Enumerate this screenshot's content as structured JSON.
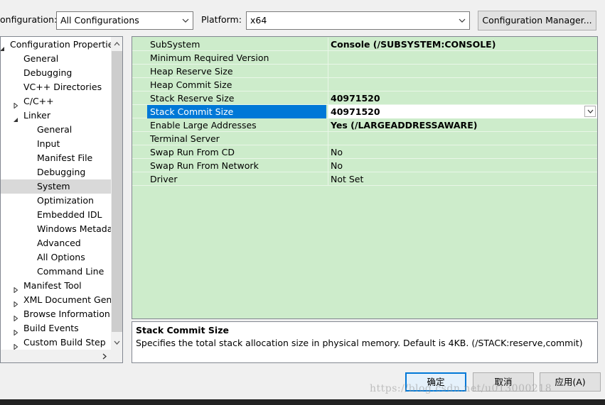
{
  "toolbar": {
    "configuration_label": "onfiguration:",
    "configuration_value": "All Configurations",
    "platform_label": "Platform:",
    "platform_value": "x64",
    "config_manager_label": "Configuration Manager..."
  },
  "tree": {
    "items": [
      {
        "label": "Configuration Properties",
        "level": 0,
        "expander": "expanded"
      },
      {
        "label": "General",
        "level": 1
      },
      {
        "label": "Debugging",
        "level": 1
      },
      {
        "label": "VC++ Directories",
        "level": 1
      },
      {
        "label": "C/C++",
        "level": 1,
        "expander": "collapsed"
      },
      {
        "label": "Linker",
        "level": 1,
        "expander": "expanded"
      },
      {
        "label": "General",
        "level": 2
      },
      {
        "label": "Input",
        "level": 2
      },
      {
        "label": "Manifest File",
        "level": 2
      },
      {
        "label": "Debugging",
        "level": 2
      },
      {
        "label": "System",
        "level": 2,
        "selected": true
      },
      {
        "label": "Optimization",
        "level": 2
      },
      {
        "label": "Embedded IDL",
        "level": 2
      },
      {
        "label": "Windows Metada",
        "level": 2
      },
      {
        "label": "Advanced",
        "level": 2
      },
      {
        "label": "All Options",
        "level": 2
      },
      {
        "label": "Command Line",
        "level": 2
      },
      {
        "label": "Manifest Tool",
        "level": 1,
        "expander": "collapsed"
      },
      {
        "label": "XML Document Gene",
        "level": 1,
        "expander": "collapsed"
      },
      {
        "label": "Browse Information",
        "level": 1,
        "expander": "collapsed"
      },
      {
        "label": "Build Events",
        "level": 1,
        "expander": "collapsed"
      },
      {
        "label": "Custom Build Step",
        "level": 1,
        "expander": "collapsed"
      }
    ]
  },
  "grid": {
    "rows": [
      {
        "name": "SubSystem",
        "value": "Console (/SUBSYSTEM:CONSOLE)",
        "bold": true
      },
      {
        "name": "Minimum Required Version",
        "value": ""
      },
      {
        "name": "Heap Reserve Size",
        "value": ""
      },
      {
        "name": "Heap Commit Size",
        "value": ""
      },
      {
        "name": "Stack Reserve Size",
        "value": "40971520",
        "bold": true
      },
      {
        "name": "Stack Commit Size",
        "value": "40971520",
        "bold": true,
        "selected": true
      },
      {
        "name": "Enable Large Addresses",
        "value": "Yes (/LARGEADDRESSAWARE)",
        "bold": true
      },
      {
        "name": "Terminal Server",
        "value": ""
      },
      {
        "name": "Swap Run From CD",
        "value": "No"
      },
      {
        "name": "Swap Run From Network",
        "value": "No"
      },
      {
        "name": "Driver",
        "value": "Not Set"
      }
    ]
  },
  "description": {
    "title": "Stack Commit Size",
    "text": "Specifies the total stack allocation size in physical memory. Default is 4KB.    (/STACK:reserve,commit)"
  },
  "buttons": {
    "ok": "确定",
    "cancel": "取消",
    "apply": "应用(A)"
  },
  "watermark": "https://blog.csdn.net/u013000218",
  "colors": {
    "grid_bg": "#cdeccb",
    "selection": "#0078d7",
    "ok_border": "#0078d7"
  }
}
